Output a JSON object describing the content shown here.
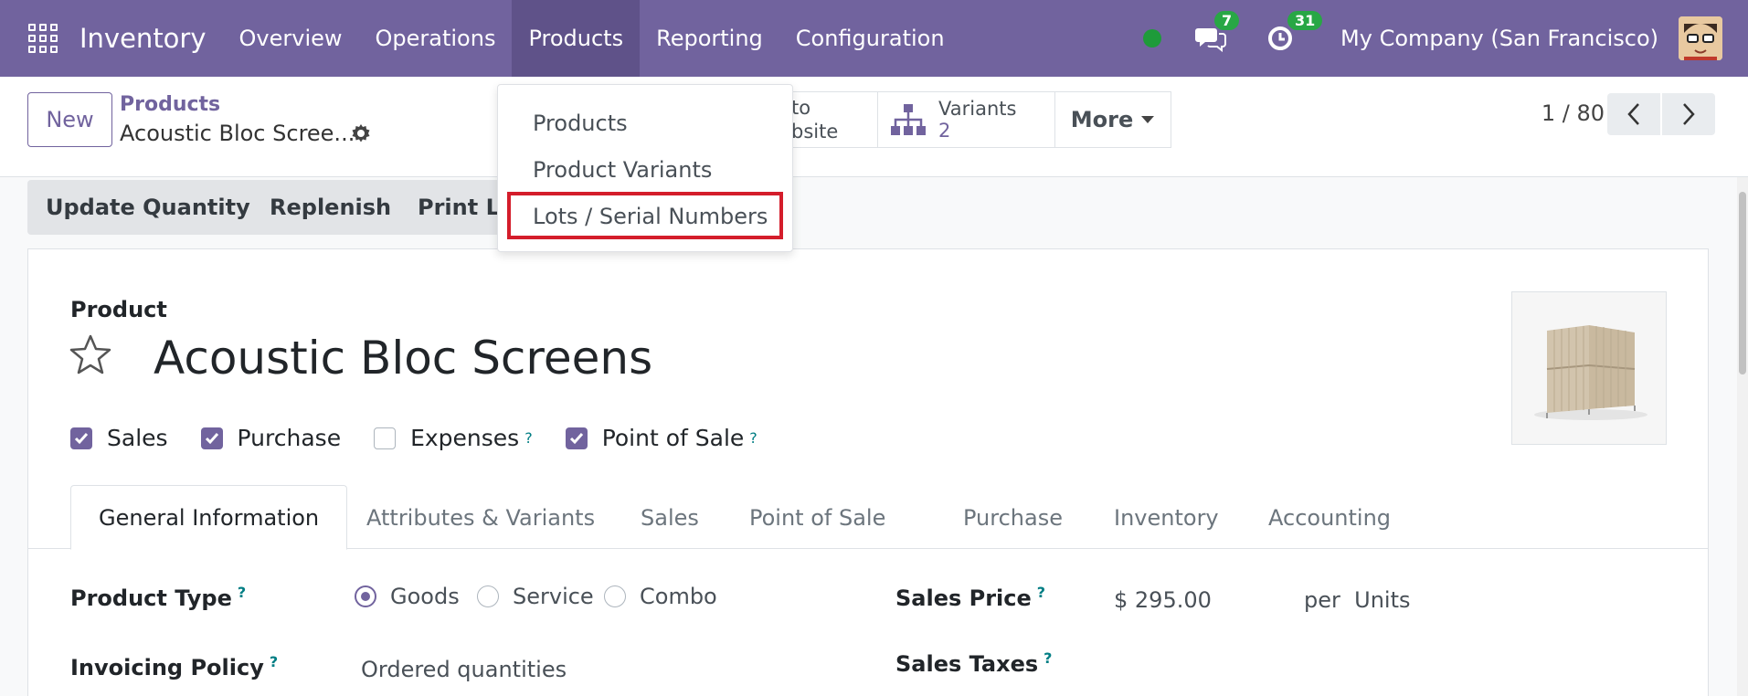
{
  "navbar": {
    "app_name": "Inventory",
    "menu": [
      "Overview",
      "Operations",
      "Products",
      "Reporting",
      "Configuration"
    ],
    "active_menu": "Products",
    "messages_count": "7",
    "activities_count": "31",
    "company": "My Company (San Francisco)"
  },
  "control": {
    "new_label": "New",
    "breadcrumb_parent": "Products",
    "breadcrumb_current": "Acoustic Bloc Scree...",
    "website_line1": "to",
    "website_line2": "bsite",
    "variants_label": "Variants",
    "variants_count": "2",
    "more_label": "More",
    "pager": "1 / 80"
  },
  "actions": {
    "update_quantity": "Update Quantity",
    "replenish": "Replenish",
    "print_labels": "Print La"
  },
  "dropdown": {
    "items": [
      "Products",
      "Product Variants",
      "Lots / Serial Numbers"
    ],
    "highlighted": "Lots / Serial Numbers"
  },
  "form": {
    "label_product": "Product",
    "title": "Acoustic Bloc Screens",
    "checkboxes": [
      {
        "label": "Sales",
        "checked": true
      },
      {
        "label": "Purchase",
        "checked": true
      },
      {
        "label": "Expenses",
        "checked": false,
        "help": "?"
      },
      {
        "label": "Point of Sale",
        "checked": true,
        "help": "?"
      }
    ],
    "tabs": [
      "General Information",
      "Attributes & Variants",
      "Sales",
      "Point of Sale",
      "Purchase",
      "Inventory",
      "Accounting"
    ],
    "active_tab": "General Information",
    "product_type_label": "Product Type",
    "product_type_options": [
      "Goods",
      "Service",
      "Combo"
    ],
    "product_type_selected": "Goods",
    "invoicing_policy_label": "Invoicing Policy",
    "invoicing_policy_value": "Ordered quantities",
    "sales_price_label": "Sales Price",
    "sales_price_value": "$ 295.00",
    "sales_price_unit": "per  Units",
    "sales_taxes_label": "Sales Taxes",
    "help_mark": "?"
  },
  "colors": {
    "brand": "#71639e",
    "badge": "#28a745",
    "highlight": "#d41d2b",
    "status": "#1e9b3a"
  }
}
